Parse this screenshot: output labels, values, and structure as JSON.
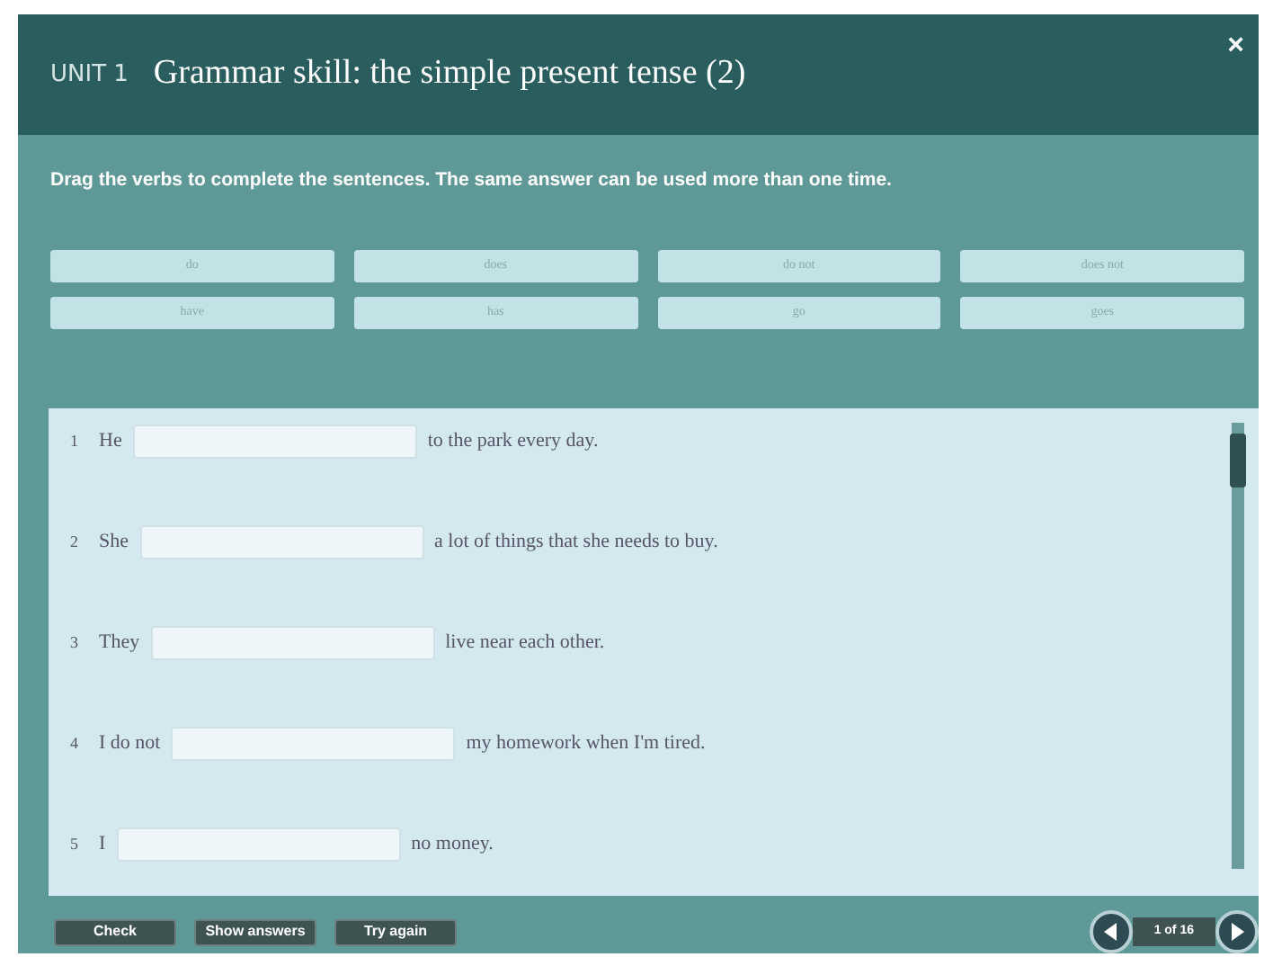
{
  "header": {
    "unit": "UNIT 1",
    "title": "Grammar skill: the simple present tense (2)",
    "close": "×"
  },
  "instruction": "Drag the verbs to complete the sentences. The same answer can be used more than one time.",
  "verbs": [
    "do",
    "does",
    "do not",
    "does not",
    "have",
    "has",
    "go",
    "goes"
  ],
  "sentences": [
    {
      "number": "1",
      "before": "He",
      "after": "to the park every day."
    },
    {
      "number": "2",
      "before": "She",
      "after": "a lot of things that she needs to buy."
    },
    {
      "number": "3",
      "before": "They",
      "after": "live near each other."
    },
    {
      "number": "4",
      "before": "I do not",
      "after": "my homework when I'm tired."
    },
    {
      "number": "5",
      "before": "I",
      "after": "no money."
    }
  ],
  "buttons": [
    "Check",
    "Show answers",
    "Try again"
  ],
  "pager": {
    "label": "1 of 16"
  }
}
